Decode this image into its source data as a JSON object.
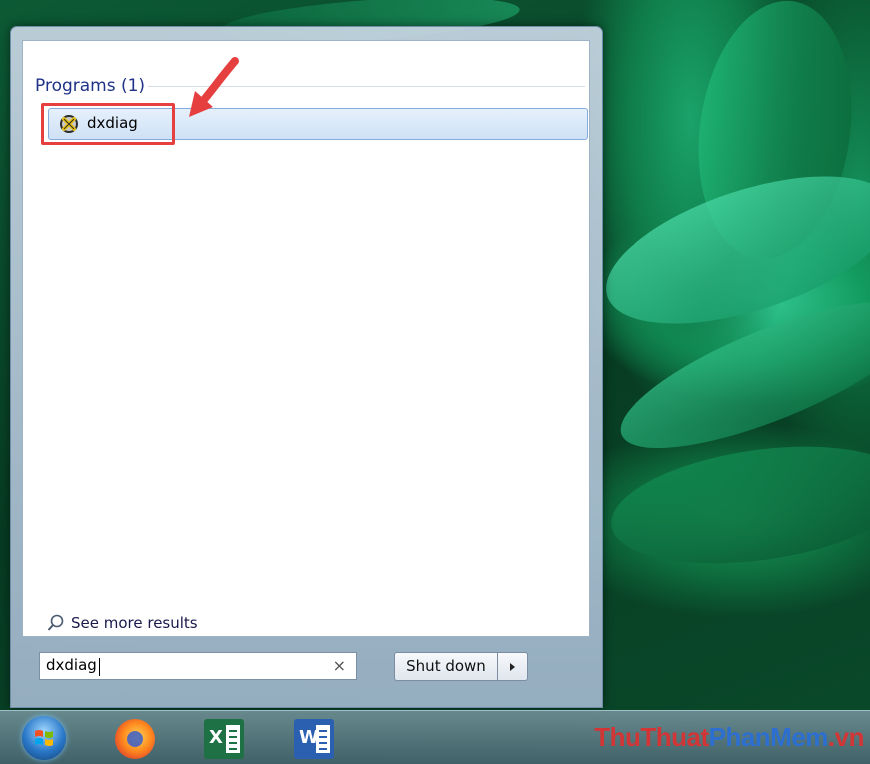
{
  "start_menu": {
    "programs_header": "Programs (1)",
    "program_item": {
      "label": "dxdiag",
      "icon": "directx-icon"
    },
    "see_more_label": "See more results",
    "search": {
      "value": "dxdiag",
      "clear_icon": "×"
    },
    "shutdown_label": "Shut down"
  },
  "taskbar": {
    "icons": [
      "start-orb-icon",
      "firefox-icon",
      "excel-icon",
      "word-icon"
    ],
    "excel_letter": "X",
    "word_letter": "W"
  },
  "watermark": {
    "part1": "ThuThuat",
    "part2": "PhanMem",
    "part3": ".vn"
  },
  "colors": {
    "highlight": "#e53f3f",
    "header_text": "#1e3287"
  }
}
